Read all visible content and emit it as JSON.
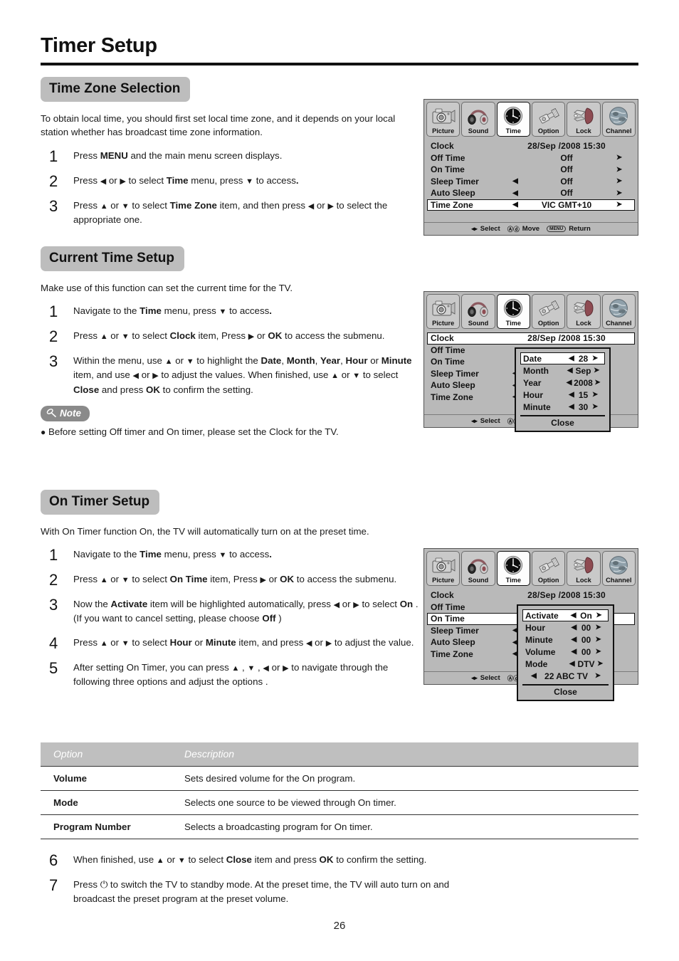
{
  "page": {
    "title": "Timer Setup",
    "number": "26"
  },
  "sections": {
    "timezone": {
      "heading": "Time Zone Selection",
      "intro": "To obtain local time, you should first set local time zone, and it depends on your local station whether has broadcast time zone information.",
      "steps": [
        {
          "num": "1",
          "html": "Press <b>MENU</b> and the main menu screen displays."
        },
        {
          "num": "2",
          "html": "Press <span class=\"ar\">&#9664;</span> or <span class=\"ar\">&#9654;</span> to select <b>Time</b> menu, press <span class=\"ar\">&#9660;</span> to access<b>.</b>"
        },
        {
          "num": "3",
          "html": "Press <span class=\"ar\">&#9650;</span> or <span class=\"ar\">&#9660;</span> to select <b>Time Zone</b> item, and then press <span class=\"ar\">&#9664;</span> or <span class=\"ar\">&#9654;</span> to select the appropriate one."
        }
      ]
    },
    "currenttime": {
      "heading": "Current Time Setup",
      "intro": "Make use of this function can set the current time for the TV.",
      "steps": [
        {
          "num": "1",
          "html": "Navigate to the <b>Time</b> menu,  press <span class=\"ar\">&#9660;</span> to access<b>.</b>"
        },
        {
          "num": "2",
          "html": "Press <span class=\"ar\">&#9650;</span> or <span class=\"ar\">&#9660;</span> to select <b>Clock</b> item, Press <span class=\"ar\">&#9654;</span> or <b>OK</b> to access the submenu."
        },
        {
          "num": "3",
          "html": "Within the menu, use <span class=\"ar\">&#9650;</span> or <span class=\"ar\">&#9660;</span> to highlight the <b>Date</b>, <b>Month</b>, <b>Year</b>, <b>Hour</b> or <b>Minute</b> item, and use <span class=\"ar\">&#9664;</span> or <span class=\"ar\">&#9654;</span> to adjust the values. When finished, use <span class=\"ar\">&#9650;</span> or <span class=\"ar\">&#9660;</span> to select <b>Close</b> and press <b>OK</b> to confirm the setting."
        }
      ],
      "note_label": "Note",
      "note_text": "Before setting Off timer and On timer, please set the Clock for the TV."
    },
    "ontimer": {
      "heading": "On Timer Setup",
      "intro": "With On Timer function On, the TV will automatically turn on at the preset time.",
      "steps": [
        {
          "num": "1",
          "html": "Navigate to the <b>Time</b> menu,  press <span class=\"ar\">&#9660;</span> to access<b>.</b>"
        },
        {
          "num": "2",
          "html": "Press <span class=\"ar\">&#9650;</span> or <span class=\"ar\">&#9660;</span> to select <b>On Time</b> item, Press <span class=\"ar\">&#9654;</span> or <b>OK</b> to access the submenu."
        },
        {
          "num": "3",
          "html": "Now the <b>Activate</b> item will be highlighted automatically, press <span class=\"ar\">&#9664;</span> or <span class=\"ar\">&#9654;</span> to select <b>On</b> . (If you want to cancel setting, please choose <b>Off</b> )"
        },
        {
          "num": "4",
          "html": "Press <span class=\"ar\">&#9650;</span> or <span class=\"ar\">&#9660;</span> to select <b>Hour</b> or <b>Minute</b> item, and press <span class=\"ar\">&#9664;</span> or <span class=\"ar\">&#9654;</span> to adjust the value."
        },
        {
          "num": "5",
          "html": "After setting On Timer, you can press <span class=\"ar\">&#9650;</span> , <span class=\"ar\">&#9660;</span> , <span class=\"ar\">&#9664;</span> or <span class=\"ar\">&#9654;</span> to navigate through the following three options and adjust the options ."
        }
      ],
      "steps_after": [
        {
          "num": "6",
          "html": "When finished, use <span class=\"ar\">&#9650;</span> or <span class=\"ar\">&#9660;</span> to select <b>Close</b> item and press <b>OK</b> to confirm the setting."
        },
        {
          "num": "7",
          "html": "Press <span class=\"pwr\">&#9211;</span> to switch the TV to standby mode. At the preset time, the TV will auto turn on and broadcast the preset program at the preset volume."
        }
      ]
    }
  },
  "option_table": {
    "headers": [
      "Option",
      "Description"
    ],
    "rows": [
      [
        "Volume",
        "Sets desired volume for the On program."
      ],
      [
        "Mode",
        "Selects one source to be viewed through On timer."
      ],
      [
        "Program Number",
        "Selects a broadcasting program for On timer."
      ]
    ]
  },
  "osd_common": {
    "tabs": [
      {
        "label": "Picture",
        "icon": "camera-icon"
      },
      {
        "label": "Sound",
        "icon": "headphones-icon"
      },
      {
        "label": "Time",
        "icon": "clock-icon"
      },
      {
        "label": "Option",
        "icon": "tool-icon"
      },
      {
        "label": "Lock",
        "icon": "clamp-lock-icon"
      },
      {
        "label": "Channel",
        "icon": "globe-icon"
      }
    ],
    "active_tab": "Time",
    "footer": {
      "select_keys": "◂▸",
      "select_label": "Select",
      "move_keys": "ⒶⓋ",
      "move_label": "Move",
      "menu_key": "MENU",
      "return_label": "Return"
    }
  },
  "osd1": {
    "rows": [
      {
        "label": "Clock",
        "left": "",
        "value": "28/Sep  /2008 15:30",
        "right": "",
        "selected": false,
        "type": "clock"
      },
      {
        "label": "Off Time",
        "left": "",
        "value": "Off",
        "right": "➤",
        "selected": false
      },
      {
        "label": "On Time",
        "left": "",
        "value": "Off",
        "right": "➤",
        "selected": false
      },
      {
        "label": "Sleep Timer",
        "left": "◀",
        "value": "Off",
        "right": "➤",
        "selected": false
      },
      {
        "label": "Auto Sleep",
        "left": "◀",
        "value": "Off",
        "right": "➤",
        "selected": false
      },
      {
        "label": "Time Zone",
        "left": "◀",
        "value": "VIC GMT+10",
        "right": "➤",
        "selected": true
      }
    ]
  },
  "osd2": {
    "rows": [
      {
        "label": "Clock",
        "left": "",
        "value": "28/Sep  /2008 15:30",
        "right": "",
        "selected": true,
        "type": "clock"
      },
      {
        "label": "Off Time",
        "left": "",
        "value": "",
        "right": "",
        "selected": false
      },
      {
        "label": "On Time",
        "left": "",
        "value": "",
        "right": "",
        "selected": false
      },
      {
        "label": "Sleep Timer",
        "left": "◀",
        "value": "",
        "right": "",
        "selected": false
      },
      {
        "label": "Auto Sleep",
        "left": "◀",
        "value": "",
        "right": "",
        "selected": false
      },
      {
        "label": "Time Zone",
        "left": "◀",
        "value": "",
        "right": "",
        "selected": false
      }
    ],
    "popup": {
      "rows": [
        {
          "label": "Date",
          "value": "28",
          "selected": true
        },
        {
          "label": "Month",
          "value": "Sep",
          "selected": false
        },
        {
          "label": "Year",
          "value": "2008",
          "selected": false
        },
        {
          "label": "Hour",
          "value": "15",
          "selected": false
        },
        {
          "label": "Minute",
          "value": "30",
          "selected": false
        }
      ],
      "close_label": "Close"
    }
  },
  "osd3": {
    "rows": [
      {
        "label": "Clock",
        "left": "",
        "value": "28/Sep  /2008 15:30",
        "right": "",
        "selected": false,
        "type": "clock"
      },
      {
        "label": "Off Time",
        "left": "",
        "value": "",
        "right": "",
        "selected": false
      },
      {
        "label": "On Time",
        "left": "",
        "value": "",
        "right": "",
        "selected": true
      },
      {
        "label": "Sleep Timer",
        "left": "◀",
        "value": "",
        "right": "",
        "selected": false
      },
      {
        "label": "Auto Sleep",
        "left": "◀",
        "value": "",
        "right": "",
        "selected": false
      },
      {
        "label": "Time Zone",
        "left": "◀",
        "value": "",
        "right": "",
        "selected": false
      }
    ],
    "popup": {
      "rows": [
        {
          "label": "Activate",
          "value": "On",
          "selected": true
        },
        {
          "label": "Hour",
          "value": "00",
          "selected": false
        },
        {
          "label": "Minute",
          "value": "00",
          "selected": false
        },
        {
          "label": "Volume",
          "value": "00",
          "selected": false
        },
        {
          "label": "Mode",
          "value": "DTV",
          "selected": false
        }
      ],
      "channel_row": {
        "value": "22 ABC TV"
      },
      "close_label": "Close"
    }
  },
  "colors": {
    "osd_background": "#b9b9b9",
    "osd_selected": "#ffffff",
    "section_badge": "#bdbdbd",
    "note_badge": "#8a8a8a",
    "table_header": "#bfbfbf",
    "rule": "#111111"
  }
}
